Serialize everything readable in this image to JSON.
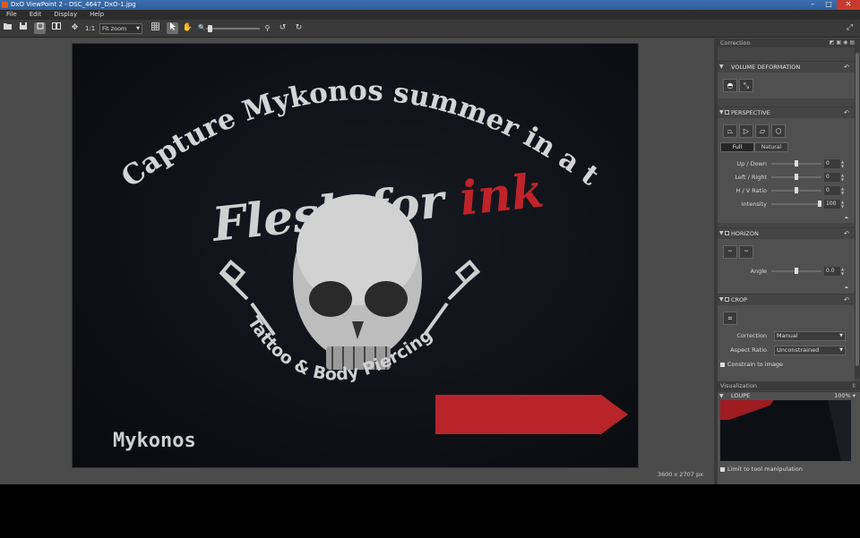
{
  "titlebar": {
    "title": "DxO ViewPoint 2 - DSC_4647_DxO-1.jpg",
    "icon": "app-icon",
    "buttons": {
      "minimize": "–",
      "maximize": "□",
      "close": "✕"
    }
  },
  "menu": [
    "File",
    "Edit",
    "Display",
    "Help"
  ],
  "toolbar": {
    "icons": [
      "folder-open-icon",
      "save-icon",
      "single-view-icon",
      "compare-view-icon",
      "move-icon",
      "grid-icon",
      "select-tool-icon",
      "hand-tool-icon",
      "zoom-icon",
      "rotate-left-icon",
      "rotate-right-icon",
      "fullscreen-icon"
    ],
    "one_to_one": "1:1",
    "zoom_mode": "Fit zoom"
  },
  "viewer": {
    "image_dimensions": "3600 x 2707 px",
    "photo_text": {
      "arc_title": "Capture Mykonos summer in a tattoo",
      "brand_part1": "Flesh for ",
      "brand_part2": "ink",
      "studio": "Tattoo & Body Piercing Studio",
      "location": "Mykonos"
    },
    "colors": {
      "accent_red": "#c0232a",
      "print_white": "#d4d4d4",
      "background": "#0f1117"
    }
  },
  "panel": {
    "title": "Correction",
    "sections": {
      "volume": {
        "title": "VOLUME DEFORMATION",
        "tools": [
          "cylindrical-icon",
          "diagonal-icon"
        ]
      },
      "perspective": {
        "title": "PERSPECTIVE",
        "tools": [
          "vertical-perspective-icon",
          "horizontal-perspective-icon",
          "rectangle-icon",
          "eight-point-icon"
        ],
        "mode_full": "Full",
        "mode_natural": "Natural",
        "sliders": [
          {
            "label": "Up / Down",
            "value": "0",
            "fraction": 0.5
          },
          {
            "label": "Left / Right",
            "value": "0",
            "fraction": 0.5
          },
          {
            "label": "H / V Ratio",
            "value": "0",
            "fraction": 0.5
          },
          {
            "label": "Intensity",
            "value": "100",
            "fraction": 1.0
          }
        ]
      },
      "horizon": {
        "title": "HORIZON",
        "tools": [
          "horizon-auto-icon",
          "horizon-manual-icon"
        ],
        "slider": {
          "label": "Angle",
          "value": "0.0",
          "fraction": 0.5
        }
      },
      "crop": {
        "title": "CROP",
        "correction_label": "Correction",
        "correction_value": "Manual",
        "aspect_label": "Aspect Ratio",
        "aspect_value": "Unconstrained",
        "constrain_label": "Constrain to image"
      }
    },
    "visualization": {
      "title": "Visualization",
      "loupe_title": "LOUPE",
      "loupe_zoom": "100%",
      "limit_label": "Limit to tool manipulation"
    }
  }
}
